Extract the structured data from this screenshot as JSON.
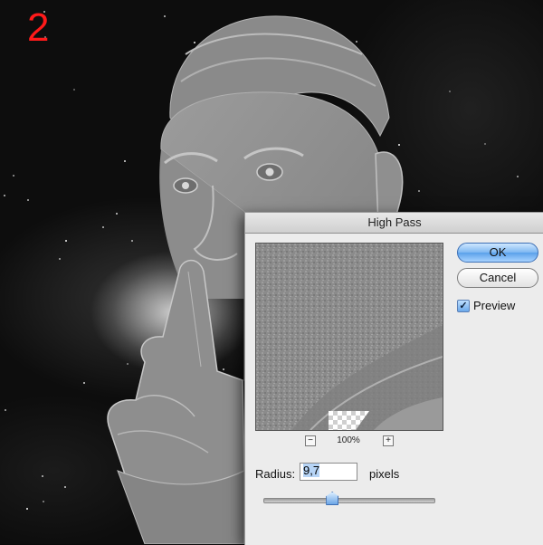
{
  "step": {
    "number": "2"
  },
  "dialog": {
    "title": "High Pass",
    "ok_label": "OK",
    "cancel_label": "Cancel",
    "preview_label": "Preview",
    "preview_checked": true,
    "zoom_out": "−",
    "zoom_in": "+",
    "zoom_level": "100%",
    "radius_label": "Radius:",
    "radius_value": "9,7",
    "radius_units": "pixels",
    "slider_level": 0.4
  },
  "colors": {
    "step_number": "#ff1a1a",
    "default_button": "#5aa0ea"
  },
  "icons": {
    "preview_checkbox": "checkmark-icon"
  }
}
